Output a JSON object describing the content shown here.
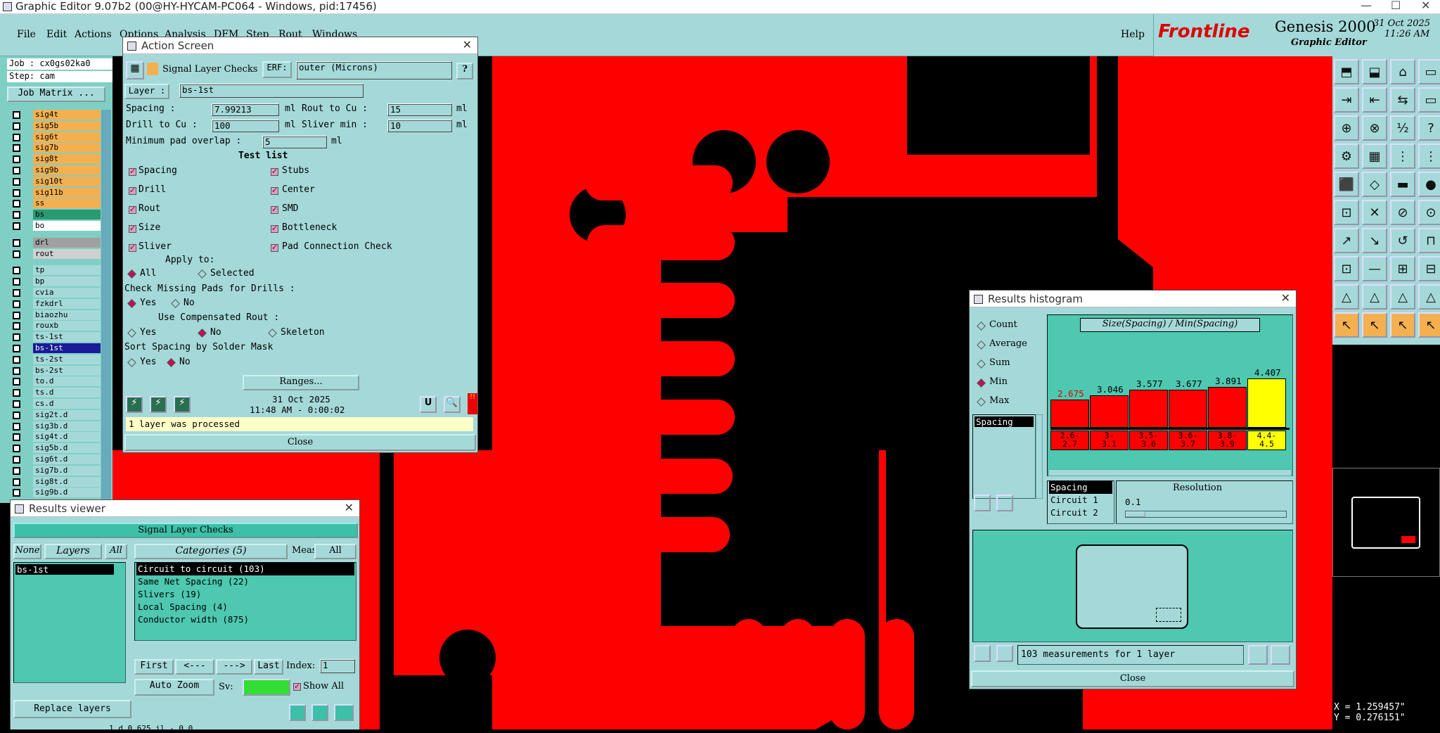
{
  "app": {
    "title": "Graphic Editor 9.07b2 (00@HY-HYCAM-PC064 - Windows, pid:17456)",
    "min": "—",
    "max": "☐",
    "close": "✕"
  },
  "menu": {
    "items": [
      "File",
      "Edit",
      "Actions",
      "Options",
      "Analysis",
      "DFM",
      "Step",
      "Rout",
      "Windows"
    ],
    "help": "Help"
  },
  "brand": {
    "logo": "Frontline",
    "product": "Genesis 2000",
    "sub": "Graphic Editor",
    "date": "31 Oct 2025",
    "time": "11:26 AM"
  },
  "left": {
    "job": "Job : cx0gs02ka0",
    "step": "Step: cam",
    "job_matrix": "Job Matrix ...",
    "layers": [
      {
        "name": "sig4t",
        "c": "#f4b050"
      },
      {
        "name": "sig5b",
        "c": "#f4b050"
      },
      {
        "name": "sig6t",
        "c": "#f4b050"
      },
      {
        "name": "sig7b",
        "c": "#f4b050"
      },
      {
        "name": "sig8t",
        "c": "#f4b050"
      },
      {
        "name": "sig9b",
        "c": "#f4b050"
      },
      {
        "name": "sig10t",
        "c": "#f4b050"
      },
      {
        "name": "sig11b",
        "c": "#f4b050"
      },
      {
        "name": "ss",
        "c": "#f4b050"
      },
      {
        "name": "bs",
        "c": "#2a9a70"
      },
      {
        "name": "bo",
        "c": "#ffffff"
      },
      {
        "name": "drl",
        "c": "#a0a0a0"
      },
      {
        "name": "rout",
        "c": "#d0d0d0"
      },
      {
        "name": "tp",
        "c": "#a5d9d9"
      },
      {
        "name": "bp",
        "c": "#a5d9d9"
      },
      {
        "name": "cvia",
        "c": "#a5d9d9"
      },
      {
        "name": "fzkdrl",
        "c": "#a5d9d9"
      },
      {
        "name": "biaozhu",
        "c": "#a5d9d9"
      },
      {
        "name": "rouxb",
        "c": "#a5d9d9"
      },
      {
        "name": "ts-1st",
        "c": "#a5d9d9"
      },
      {
        "name": "bs-1st",
        "c": "#ff0000"
      },
      {
        "name": "ts-2st",
        "c": "#a5d9d9"
      },
      {
        "name": "bs-2st",
        "c": "#a5d9d9"
      },
      {
        "name": "to.d",
        "c": "#a5d9d9"
      },
      {
        "name": "ts.d",
        "c": "#a5d9d9"
      },
      {
        "name": "cs.d",
        "c": "#a5d9d9"
      },
      {
        "name": "sig2t.d",
        "c": "#a5d9d9"
      },
      {
        "name": "sig3b.d",
        "c": "#a5d9d9"
      },
      {
        "name": "sig4t.d",
        "c": "#a5d9d9"
      },
      {
        "name": "sig5b.d",
        "c": "#a5d9d9"
      },
      {
        "name": "sig6t.d",
        "c": "#a5d9d9"
      },
      {
        "name": "sig7b.d",
        "c": "#a5d9d9"
      },
      {
        "name": "sig8t.d",
        "c": "#a5d9d9"
      },
      {
        "name": "sig9b.d",
        "c": "#a5d9d9"
      }
    ]
  },
  "action": {
    "title": "Action Screen",
    "check": "Signal Layer Checks",
    "erf_label": "ERF:",
    "erf": "outer (Microns)",
    "help": "?",
    "layer_label": "Layer :",
    "layer": "bs-1st",
    "spacing_label": "Spacing    :",
    "spacing": "7.99213",
    "unit": "ml",
    "rout_label": "Rout to Cu  :",
    "rout": "15",
    "drill_label": "Drill to Cu :",
    "drill": "100",
    "sliver_label": "Sliver min  :",
    "sliver": "10",
    "overlap_label": "Minimum pad overlap :",
    "overlap": "5",
    "test_list": "Test list",
    "tests_left": [
      "Spacing",
      "Drill",
      "Rout",
      "Size",
      "Sliver"
    ],
    "tests_right": [
      "Stubs",
      "Center",
      "SMD",
      "Bottleneck",
      "Pad Connection Check"
    ],
    "apply": "Apply to:",
    "all": "All",
    "selected": "Selected",
    "missing": "Check Missing Pads for Drills :",
    "yes": "Yes",
    "no": "No",
    "comp": "Use Compensated Rout :",
    "skeleton": "Skeleton",
    "sort": "Sort Spacing by Solder Mask",
    "ranges": "Ranges...",
    "date": "31 Oct 2025",
    "time": "11:48 AM - 0:00:02",
    "status": "1 layer was processed",
    "close": "Close"
  },
  "results": {
    "title": "Results viewer",
    "header": "Signal Layer Checks",
    "none": "None",
    "layers": "Layers",
    "all": "All",
    "categories": "Categories (5)",
    "meas": "Meas:",
    "meas_val": "All",
    "layer_list": [
      "bs-1st"
    ],
    "cats": [
      "Circuit to circuit (103)",
      "Same Net Spacing (22)",
      "Slivers (19)",
      "Local Spacing (4)",
      "Conductor width (875)"
    ],
    "first": "First",
    "prev": "<---",
    "next": "--->",
    "last": "Last",
    "index_label": "Index:",
    "index": "1",
    "autozoom": "Auto Zoom",
    "sv": "Sv:",
    "show_all": "Show All",
    "replace": "Replace layers",
    "bottom": "1 d 0.625 il - 0.0"
  },
  "hist": {
    "title": "Results histogram",
    "modes": [
      "Count",
      "Average",
      "Sum",
      "Min",
      "Max"
    ],
    "active": "Min",
    "heading": "Size(Spacing) / Min(Spacing)",
    "bars": [
      {
        "v": "2.675",
        "r": "2.6-\n2.7",
        "hi": false
      },
      {
        "v": "3.046",
        "r": "3-\n3.1",
        "hi": false
      },
      {
        "v": "3.577",
        "r": "3.5-\n3.6",
        "hi": false
      },
      {
        "v": "3.677",
        "r": "3.6-\n3.7",
        "hi": false
      },
      {
        "v": "3.891",
        "r": "3.8-\n3.9",
        "hi": false
      },
      {
        "v": "4.407",
        "r": "4.4-\n4.5",
        "hi": true
      }
    ],
    "list": [
      "Spacing"
    ],
    "sort_list": [
      "Spacing",
      "Circuit 1",
      "Circuit 2"
    ],
    "resolution": "Resolution",
    "res_val": "0.1",
    "count": "103 measurements for 1 layer",
    "close": "Close"
  },
  "coords": {
    "x": "X = 1.259457\"",
    "y": "Y = 0.276151\""
  }
}
